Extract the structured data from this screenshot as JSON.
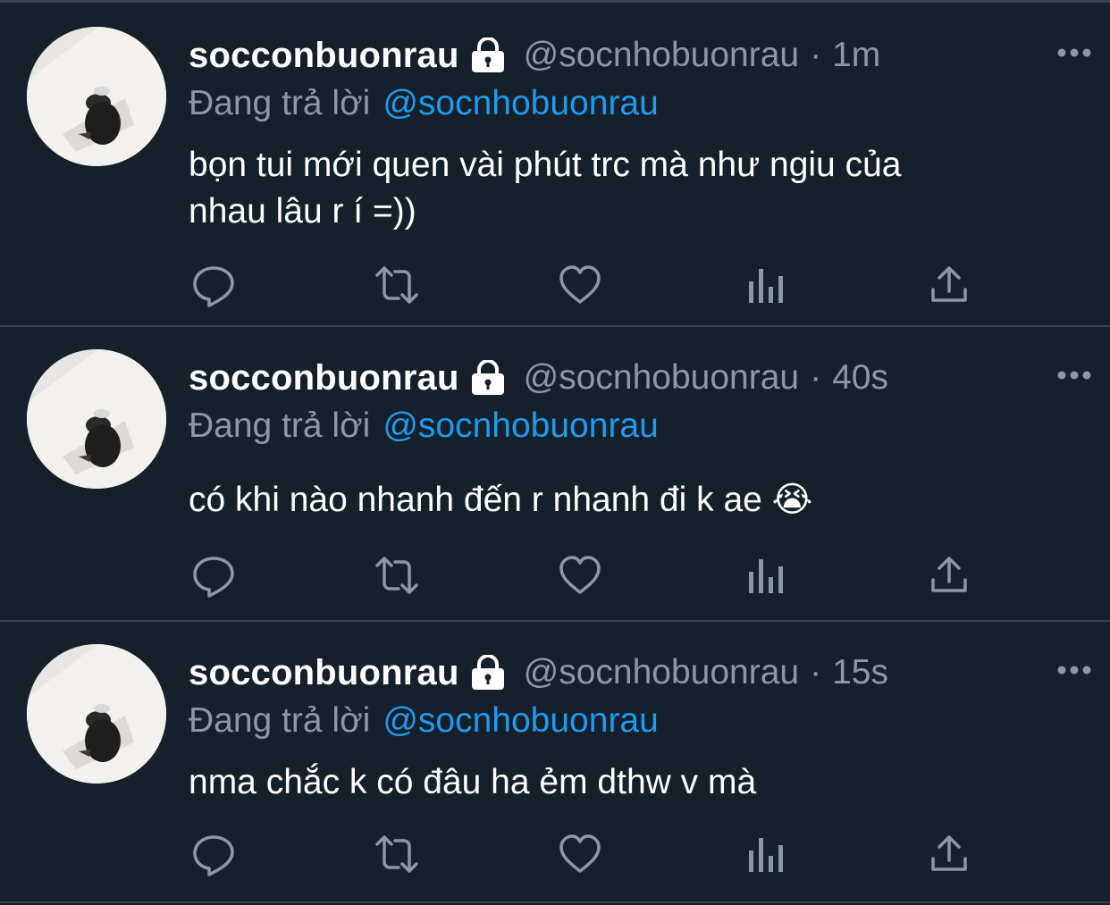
{
  "colors": {
    "background": "#15202b",
    "divider": "#38444d",
    "text_primary": "#ffffff",
    "text_secondary": "#8b98a5",
    "link": "#1d9bf0"
  },
  "icons": {
    "protected": "lock-icon",
    "more": "more-icon",
    "reply": "reply-icon",
    "retweet": "retweet-icon",
    "like": "heart-icon",
    "views": "views-icon",
    "share": "share-icon"
  },
  "tweets": [
    {
      "display_name": "socconbuonrau",
      "handle": "@socnhobuonrau",
      "separator": "·",
      "time": "1m",
      "replying_label": "Đang trả lời",
      "replying_to": "@socnhobuonrau",
      "text_line1": "bọn tui mới quen vài phút trc mà như ngiu của",
      "text_line2": "nhau lâu r í =))"
    },
    {
      "display_name": "socconbuonrau",
      "handle": "@socnhobuonrau",
      "separator": "·",
      "time": "40s",
      "replying_label": "Đang trả lời",
      "replying_to": "@socnhobuonrau",
      "text_line1": "có khi nào nhanh đến r nhanh đi k ae 😭"
    },
    {
      "display_name": "socconbuonrau",
      "handle": "@socnhobuonrau",
      "separator": "·",
      "time": "15s",
      "replying_label": "Đang trả lời",
      "replying_to": "@socnhobuonrau",
      "text_line1": "nma chắc k có đâu ha ẻm dthw v mà"
    }
  ]
}
